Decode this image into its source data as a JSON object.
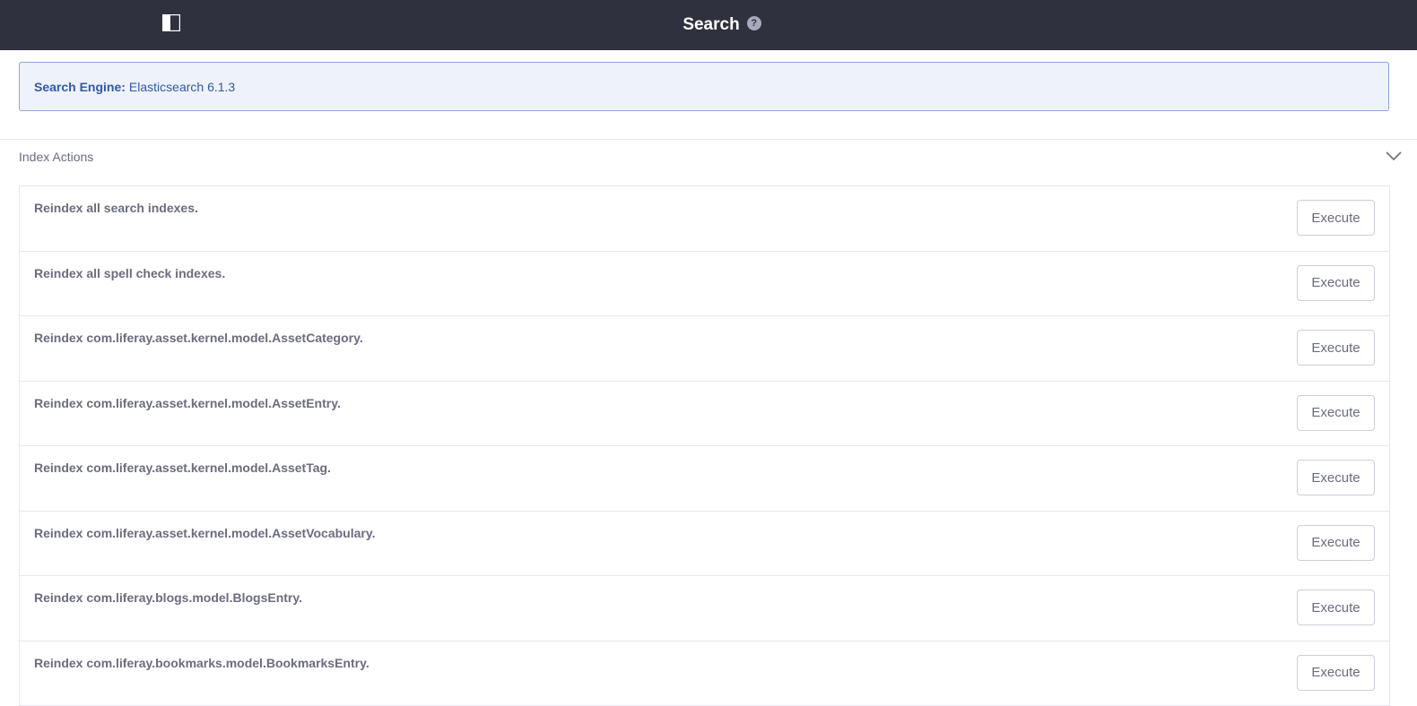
{
  "header": {
    "title": "Search",
    "help_glyph": "?",
    "icons": {
      "panel_toggle": "sidebar-toggle-icon",
      "help": "help-icon"
    }
  },
  "engine_alert": {
    "label": "Search Engine:",
    "value": "Elasticsearch 6.1.3"
  },
  "index_actions": {
    "title": "Index Actions",
    "collapse_icon": "chevron-down-icon",
    "items": [
      {
        "label": "Reindex all search indexes.",
        "button": "Execute"
      },
      {
        "label": "Reindex all spell check indexes.",
        "button": "Execute"
      },
      {
        "label": "Reindex com.liferay.asset.kernel.model.AssetCategory.",
        "button": "Execute"
      },
      {
        "label": "Reindex com.liferay.asset.kernel.model.AssetEntry.",
        "button": "Execute"
      },
      {
        "label": "Reindex com.liferay.asset.kernel.model.AssetTag.",
        "button": "Execute"
      },
      {
        "label": "Reindex com.liferay.asset.kernel.model.AssetVocabulary.",
        "button": "Execute"
      },
      {
        "label": "Reindex com.liferay.blogs.model.BlogsEntry.",
        "button": "Execute"
      },
      {
        "label": "Reindex com.liferay.bookmarks.model.BookmarksEntry.",
        "button": "Execute"
      }
    ]
  },
  "colors": {
    "topbar": "#30313f",
    "alert_background": "#eef2fa",
    "alert_border": "#89a7e0",
    "alert_text": "#2e5aac",
    "body_text": "#6b6c7e",
    "divider": "#e7e7ed"
  }
}
